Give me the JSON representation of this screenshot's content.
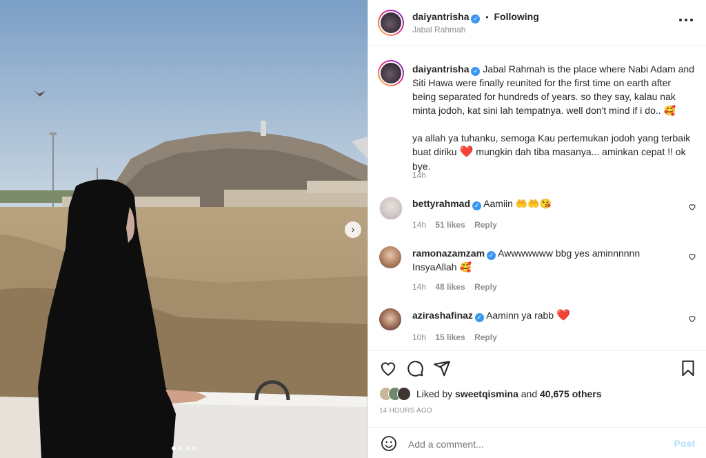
{
  "header": {
    "username": "daiyantrisha",
    "separator": "•",
    "follow_status": "Following",
    "location": "Jabal Rahmah",
    "more_icon": "more-horizontal-icon"
  },
  "caption": {
    "username": "daiyantrisha",
    "paragraph1": "Jabal Rahmah is the place where Nabi Adam and Siti Hawa were finally reunited for the first time on earth after being separated for hundreds of years. so they say, kalau nak minta jodoh, kat sini lah tempatnya. well don't mind if i do..",
    "emoji1": "🥰",
    "paragraph2": "ya allah ya tuhanku, semoga Kau pertemukan jodoh yang terbaik buat diriku",
    "heart_emoji": "❤️",
    "paragraph2_rest": "mungkin dah tiba masanya... aminkan cepat !! ok bye.",
    "time": "14h"
  },
  "comments": [
    {
      "username": "bettyrahmad",
      "text": "Aamiin 🤲🤲😘",
      "time": "14h",
      "likes": "51 likes",
      "reply": "Reply"
    },
    {
      "username": "ramonazamzam",
      "text": "Awwwwwww bbg yes aminnnnnn InsyaAllah 🥰",
      "time": "14h",
      "likes": "48 likes",
      "reply": "Reply"
    },
    {
      "username": "azirashafinaz",
      "text": "Aaminn ya rabb",
      "heart": "❤️",
      "time": "10h",
      "likes": "15 likes",
      "reply": "Reply"
    }
  ],
  "actions": {
    "like_icon": "heart-outline-icon",
    "comment_icon": "comment-bubble-icon",
    "share_icon": "send-paper-plane-icon",
    "save_icon": "bookmark-icon"
  },
  "likes": {
    "prefix": "Liked by",
    "user": "sweetqismina",
    "and": "and",
    "others": "40,675 others"
  },
  "timestamp": "14 HOURS AGO",
  "add_comment": {
    "placeholder": "Add a comment...",
    "post_label": "Post"
  },
  "colors": {
    "verified": "#3897f0",
    "post_button_disabled": "#b2dffc",
    "heart_red": "#ed4956"
  }
}
